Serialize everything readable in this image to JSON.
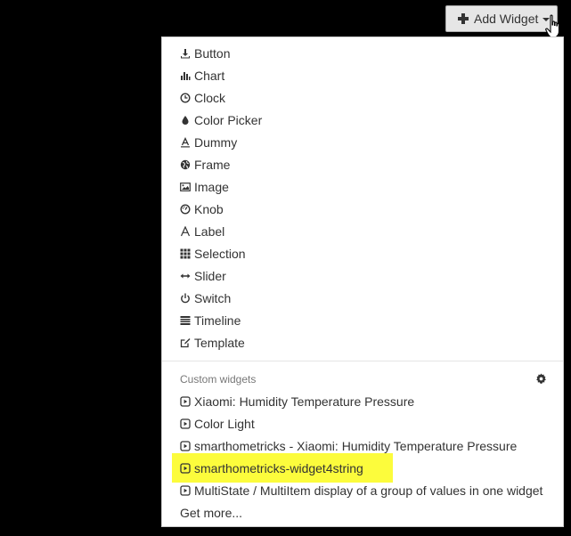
{
  "toolbar": {
    "add_widget_label": "Add Widget"
  },
  "menu": {
    "builtin": [
      {
        "label": "Button",
        "icon": "download-icon"
      },
      {
        "label": "Chart",
        "icon": "bar-chart-icon"
      },
      {
        "label": "Clock",
        "icon": "clock-icon"
      },
      {
        "label": "Color Picker",
        "icon": "tint-icon"
      },
      {
        "label": "Dummy",
        "icon": "text-format-icon"
      },
      {
        "label": "Frame",
        "icon": "globe-icon"
      },
      {
        "label": "Image",
        "icon": "image-icon"
      },
      {
        "label": "Knob",
        "icon": "dashboard-icon"
      },
      {
        "label": "Label",
        "icon": "font-icon"
      },
      {
        "label": "Selection",
        "icon": "grid-icon"
      },
      {
        "label": "Slider",
        "icon": "arrows-h-icon"
      },
      {
        "label": "Switch",
        "icon": "power-icon"
      },
      {
        "label": "Timeline",
        "icon": "list-icon"
      },
      {
        "label": "Template",
        "icon": "edit-icon"
      }
    ],
    "custom_header": "Custom widgets",
    "custom": [
      {
        "label": "Xiaomi: Humidity Temperature Pressure",
        "icon": "play-square-icon"
      },
      {
        "label": "Color Light",
        "icon": "play-square-icon"
      },
      {
        "label": "smarthometricks - Xiaomi: Humidity Temperature Pressure",
        "icon": "play-square-icon"
      },
      {
        "label": "smarthometricks-widget4string",
        "icon": "play-square-icon",
        "highlighted": true
      },
      {
        "label": "MultiState / MultiItem display of a group of values in one widget",
        "icon": "play-square-icon"
      }
    ],
    "get_more": "Get more..."
  },
  "colors": {
    "background": "#000000",
    "highlight": "#fcfc3c",
    "button_bg": "#e6e6e6"
  }
}
